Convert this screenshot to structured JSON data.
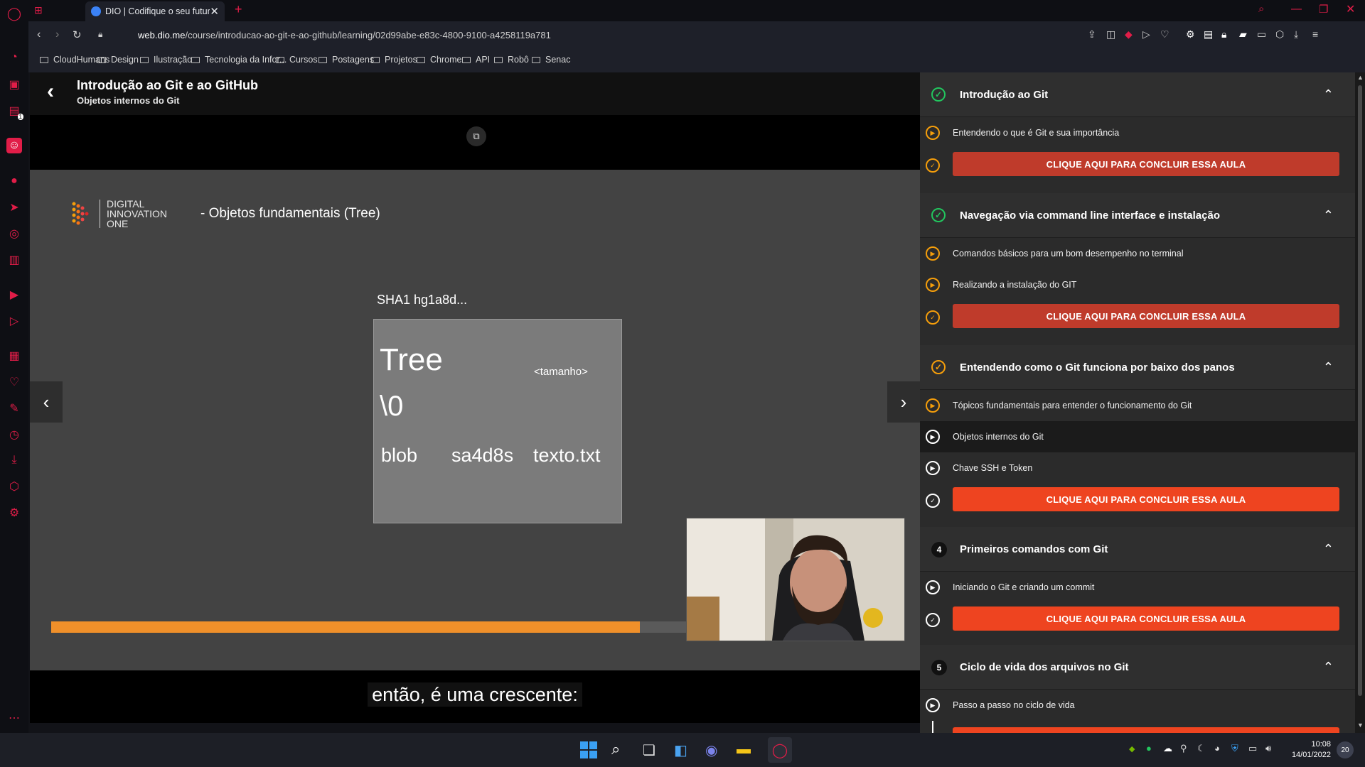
{
  "browser": {
    "tab_title": "DIO | Codifique o seu futur",
    "url_domain": "web.dio.me",
    "url_path": "/course/introducao-ao-git-e-ao-github/learning/02d99abe-e83c-4800-9100-a4258119a781",
    "bookmarks": [
      "CloudHumans",
      "Design",
      "Ilustração",
      "Tecnologia da Infor...",
      "Cursos",
      "Postagens",
      "Projetos",
      "Chrome",
      "API",
      "Robô",
      "Senac"
    ],
    "sidebar_badge": "1"
  },
  "course": {
    "title": "Introdução ao Git e ao GitHub",
    "lesson": "Objetos internos do Git"
  },
  "slide": {
    "logo_line1": "DIGITAL",
    "logo_line2": "INNOVATION",
    "logo_line3": "ONE",
    "heading": "- Objetos fundamentais (Tree)",
    "sha_label": "SHA1 hg1a8d...",
    "box_title": "Tree",
    "box_size": "<tamanho>",
    "box_null": "\\0",
    "row_type": "blob",
    "row_hash": "sa4d8s",
    "row_file": "texto.txt",
    "progress": 0.72
  },
  "caption": "então, é uma crescente:",
  "modules": [
    {
      "title": "Introdução ao Git",
      "status": "done",
      "lessons": [
        "Entendendo o que é Git e sua importância"
      ],
      "button": "CLIQUE AQUI PARA CONCLUIR ESSA AULA"
    },
    {
      "title": "Navegação via command line interface e instalação",
      "status": "done",
      "lessons": [
        "Comandos básicos para um bom desempenho no terminal",
        "Realizando a instalação do GIT"
      ],
      "button": "CLIQUE AQUI PARA CONCLUIR ESSA AULA"
    },
    {
      "title": "Entendendo como o Git funciona por baixo dos panos",
      "status": "in-progress",
      "lessons": [
        "Tópicos fundamentais para entender o funcionamento do Git",
        "Objetos internos do Git",
        "Chave SSH e Token"
      ],
      "button": "CLIQUE AQUI PARA CONCLUIR ESSA AULA"
    },
    {
      "number": "4",
      "title": "Primeiros comandos com Git",
      "status": "todo",
      "lessons": [
        "Iniciando o Git e criando um commit"
      ],
      "button": "CLIQUE AQUI PARA CONCLUIR ESSA AULA"
    },
    {
      "number": "5",
      "title": "Ciclo de vida dos arquivos no Git",
      "status": "todo",
      "lessons": [
        "Passo a passo no ciclo de vida"
      ]
    }
  ],
  "colors": {
    "done_button": "#bf3b2b",
    "active_button": "#ee4420",
    "progress": "#f0902a",
    "accent_green": "#22c55e",
    "accent_orange": "#f59e0b"
  },
  "taskbar": {
    "time": "10:08",
    "date": "14/01/2022",
    "notification_count": "20"
  }
}
